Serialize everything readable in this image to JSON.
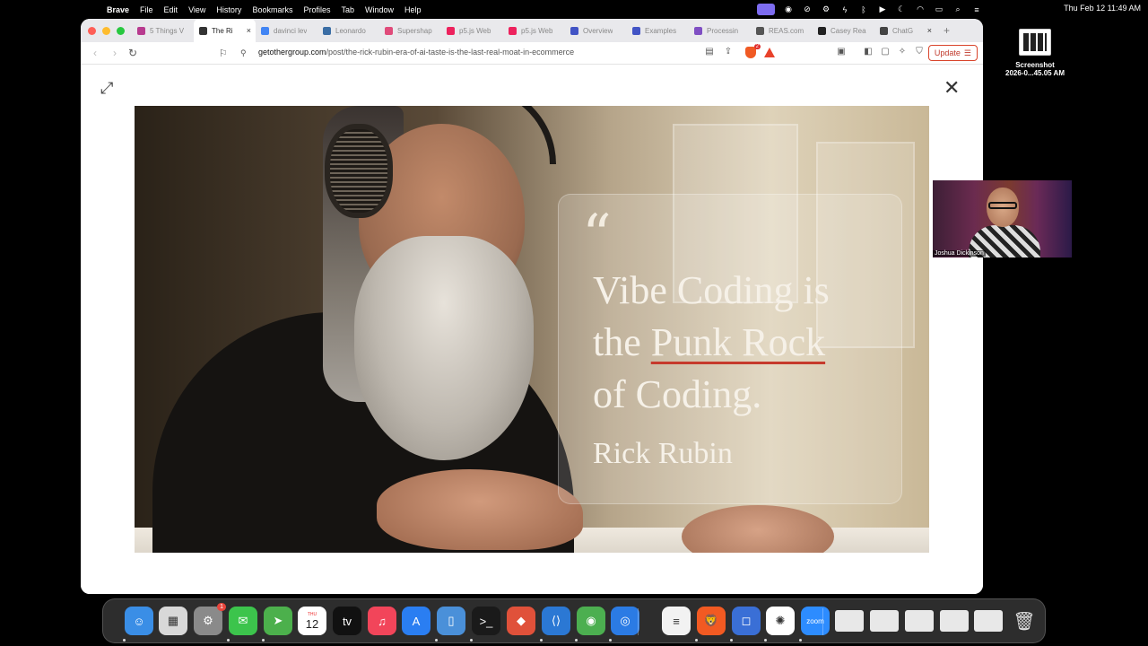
{
  "menubar": {
    "app_name": "Brave",
    "menus": [
      "File",
      "Edit",
      "View",
      "History",
      "Bookmarks",
      "Profiles",
      "Tab",
      "Window",
      "Help"
    ],
    "clock": "Thu Feb 12  11:49 AM"
  },
  "tabs": [
    {
      "label": "5 Things V",
      "favicon_color": "#b83b8f"
    },
    {
      "label": "The Ri",
      "favicon_color": "#333333",
      "active": true
    },
    {
      "label": "davinci lev",
      "favicon_color": "#4285f4"
    },
    {
      "label": "Leonardo",
      "favicon_color": "#3b6ea5"
    },
    {
      "label": "Supershap",
      "favicon_color": "#e04b7a"
    },
    {
      "label": "p5.js Web",
      "favicon_color": "#ed225d"
    },
    {
      "label": "p5.js Web",
      "favicon_color": "#ed225d"
    },
    {
      "label": "Overview",
      "favicon_color": "#4254c5"
    },
    {
      "label": "Examples",
      "favicon_color": "#4254c5"
    },
    {
      "label": "Processin",
      "favicon_color": "#7f4fc3"
    },
    {
      "label": "REAS.com",
      "favicon_color": "#555555"
    },
    {
      "label": "Casey Rea",
      "favicon_color": "#222222"
    },
    {
      "label": "ChatG",
      "favicon_color": "#444444"
    }
  ],
  "address_bar": {
    "host": "getothergroup.com",
    "path": "/post/the-rick-rubin-era-of-ai-taste-is-the-last-real-moat-in-ecommerce",
    "update_label": "Update",
    "brave_badge": "2"
  },
  "hero": {
    "quote_mark": "“",
    "quote_line1": "Vibe Coding is",
    "quote_line2_pre": "the ",
    "quote_line2_emph": "Punk Rock",
    "quote_line3": "of Coding.",
    "author": "Rick Rubin"
  },
  "desktop": {
    "file_label_1": "Screenshot",
    "file_label_2": "2026-0...45.05 AM"
  },
  "webcam": {
    "name": "Joshua Dickinson"
  },
  "dock": {
    "apps": [
      "Finder",
      "Launchpad",
      "System Settings",
      "Messages",
      "Maps",
      "Calendar",
      "TV",
      "Music",
      "App Store",
      "Simulator",
      "Terminal",
      "Git",
      "VS Code",
      "Chrome",
      "Proxyman",
      "Notes",
      "Brave",
      "Docker",
      "ChatGPT",
      "Zoom"
    ],
    "calendar_day": "12",
    "calendar_month": "THU",
    "settings_badge": "1"
  }
}
